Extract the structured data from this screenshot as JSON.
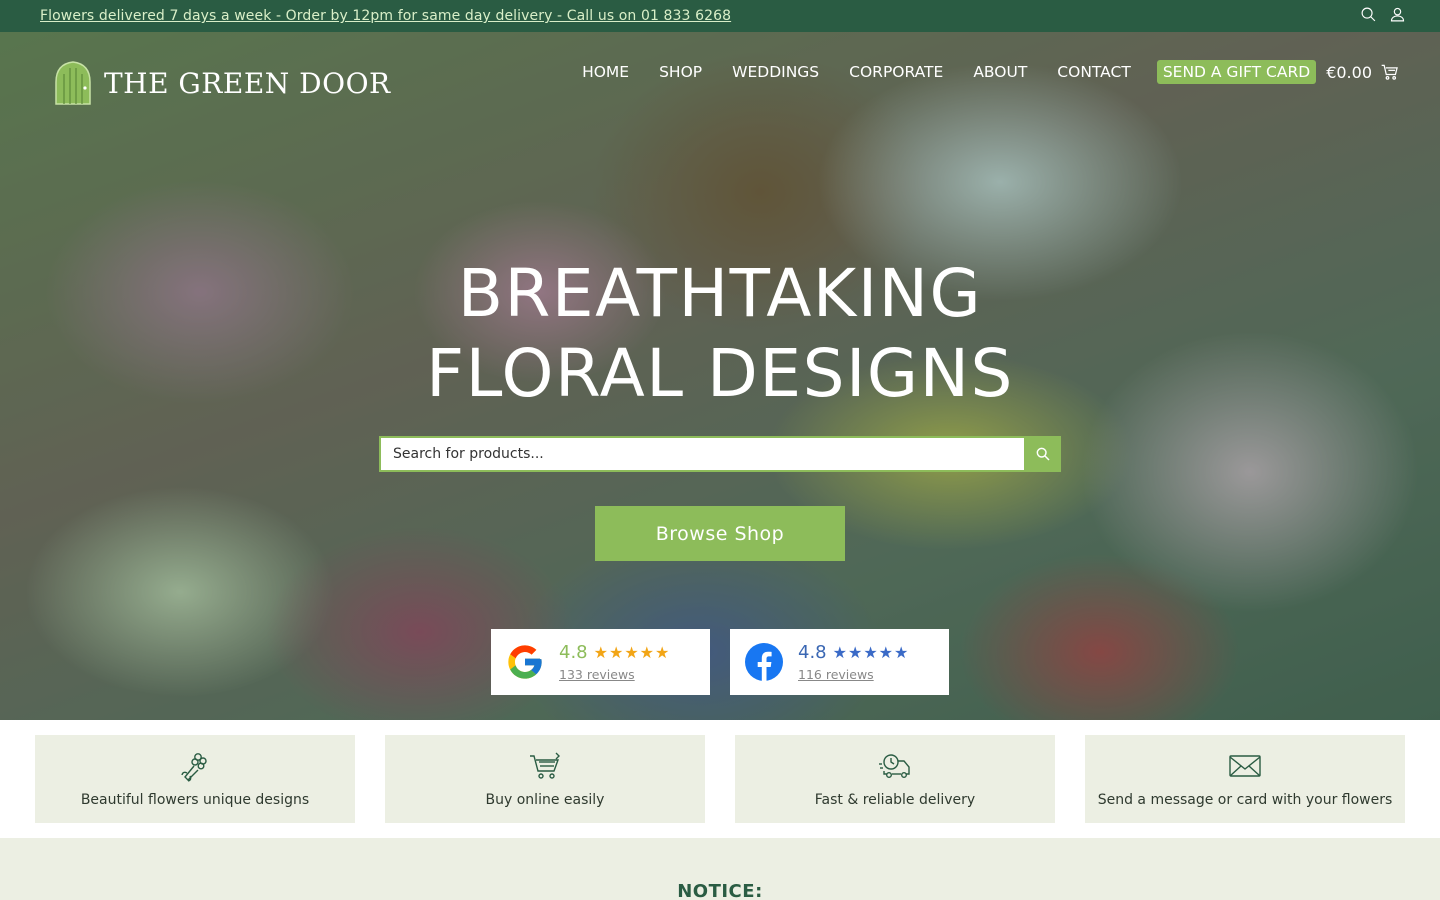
{
  "topbar": {
    "announcement": "Flowers delivered 7 days a week - Order by 12pm for same day delivery - Call us on 01 833 6268",
    "icons": [
      "search-icon",
      "user-icon"
    ]
  },
  "header": {
    "logo_text": "THE GREEN DOOR",
    "nav": [
      "HOME",
      "SHOP",
      "WEDDINGS",
      "CORPORATE",
      "ABOUT",
      "CONTACT"
    ],
    "gift_card": "SEND A GIFT CARD",
    "cart_total": "€0.00"
  },
  "hero": {
    "title_line1": "BREATHTAKING",
    "title_line2": "FLORAL DESIGNS",
    "search_placeholder": "Search for products...",
    "browse_button": "Browse Shop"
  },
  "reviews": {
    "google": {
      "rating": "4.8",
      "stars": 5,
      "count": "133 reviews"
    },
    "facebook": {
      "rating": "4.8",
      "stars": 5,
      "count": "116 reviews"
    }
  },
  "features": [
    {
      "icon": "bouquet-icon",
      "label": "Beautiful flowers unique designs"
    },
    {
      "icon": "cart-icon",
      "label": "Buy online easily"
    },
    {
      "icon": "delivery-truck-icon",
      "label": "Fast & reliable delivery"
    },
    {
      "icon": "envelope-icon",
      "label": "Send a message or card with your flowers"
    }
  ],
  "notice": {
    "title": "NOTICE:"
  },
  "colors": {
    "brand_dark": "#2a5c43",
    "accent": "#8dbc5a",
    "star": "#f2a516",
    "facebook": "#3a6ac7"
  }
}
